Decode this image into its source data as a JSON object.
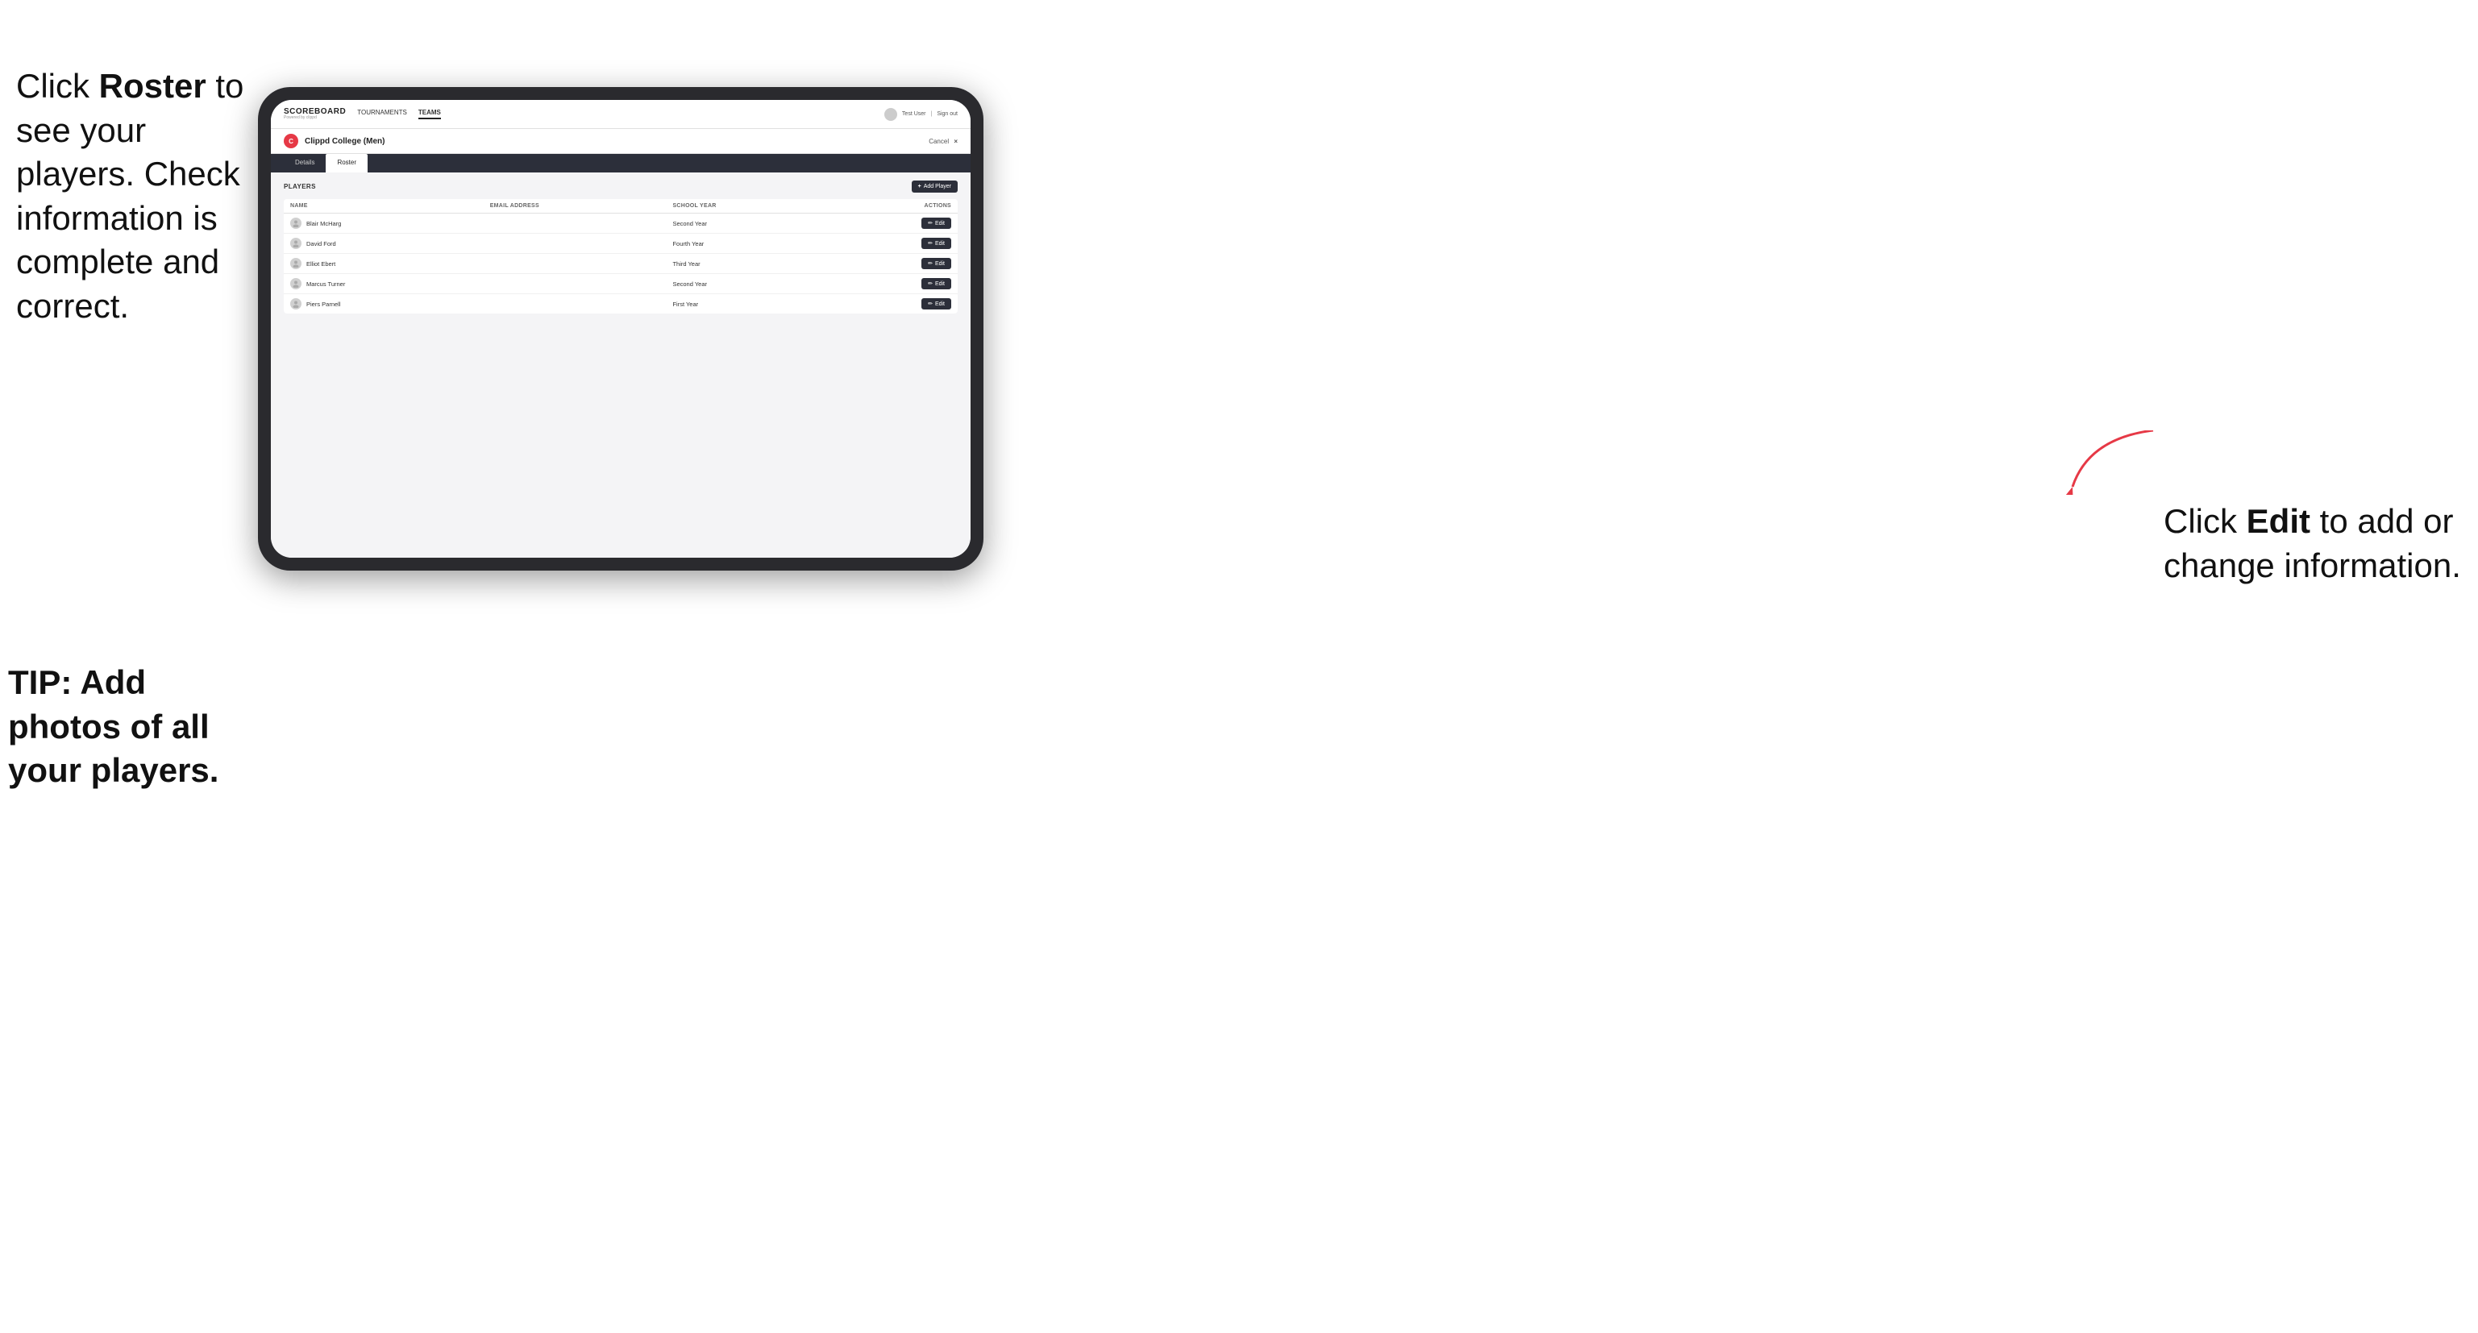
{
  "leftAnnotation": {
    "line1": "Click ",
    "bold1": "Roster",
    "line2": " to see your players. Check information is complete and correct."
  },
  "tipAnnotation": {
    "text": "TIP: Add photos of all your players."
  },
  "rightAnnotation": {
    "line1": "Click ",
    "bold1": "Edit",
    "line2": " to add or change information."
  },
  "nav": {
    "brand": "SCOREBOARD",
    "brandSub": "Powered by clippd",
    "links": [
      "TOURNAMENTS",
      "TEAMS"
    ],
    "activeLink": "TEAMS",
    "user": "Test User",
    "signOut": "Sign out"
  },
  "teamHeader": {
    "icon": "C",
    "name": "Clippd College (Men)",
    "cancel": "Cancel",
    "cancelSymbol": "×"
  },
  "tabs": [
    {
      "label": "Details",
      "active": false
    },
    {
      "label": "Roster",
      "active": true
    }
  ],
  "playersSection": {
    "label": "PLAYERS",
    "addButton": "+ Add Player"
  },
  "tableHeaders": {
    "name": "NAME",
    "email": "EMAIL ADDRESS",
    "schoolYear": "SCHOOL YEAR",
    "actions": "ACTIONS"
  },
  "players": [
    {
      "name": "Blair McHarg",
      "email": "",
      "schoolYear": "Second Year"
    },
    {
      "name": "David Ford",
      "email": "",
      "schoolYear": "Fourth Year"
    },
    {
      "name": "Elliot Ebert",
      "email": "",
      "schoolYear": "Third Year"
    },
    {
      "name": "Marcus Turner",
      "email": "",
      "schoolYear": "Second Year"
    },
    {
      "name": "Piers Parnell",
      "email": "",
      "schoolYear": "First Year"
    }
  ],
  "editButtonLabel": "Edit",
  "colors": {
    "navDark": "#2c2f3a",
    "accent": "#e63946",
    "addPlayerBg": "#2c2f3a"
  }
}
